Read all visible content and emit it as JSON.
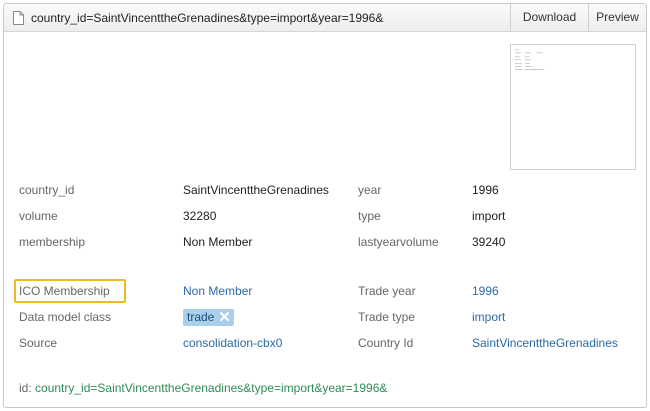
{
  "header": {
    "title": "country_id=SaintVincenttheGrenadines&type=import&year=1996&",
    "download_label": "Download",
    "preview_label": "Preview"
  },
  "attributes": [
    {
      "label": "country_id",
      "value": "SaintVincenttheGrenadines"
    },
    {
      "label": "year",
      "value": "1996"
    },
    {
      "label": "volume",
      "value": "32280"
    },
    {
      "label": "type",
      "value": "import"
    },
    {
      "label": "membership",
      "value": "Non Member"
    },
    {
      "label": "lastyearvolume",
      "value": "39240"
    }
  ],
  "metadata": {
    "ico_membership_label": "ICO Membership",
    "ico_membership_value": "Non Member",
    "trade_year_label": "Trade year",
    "trade_year_value": "1996",
    "data_model_label": "Data model class",
    "data_model_tag": "trade",
    "trade_type_label": "Trade type",
    "trade_type_value": "import",
    "source_label": "Source",
    "source_value": "consolidation-cbx0",
    "country_id_label": "Country Id",
    "country_id_value": "SaintVincenttheGrenadines"
  },
  "footer": {
    "id_label": "id:",
    "id_value": "country_id=SaintVincenttheGrenadines&type=import&year=1996&"
  },
  "colors": {
    "link": "#2a6aa8",
    "highlight": "#f0b823",
    "tag_bg": "#a9cfea",
    "id_green": "#2e8b57"
  },
  "icons": [
    "file-icon",
    "close-icon"
  ]
}
